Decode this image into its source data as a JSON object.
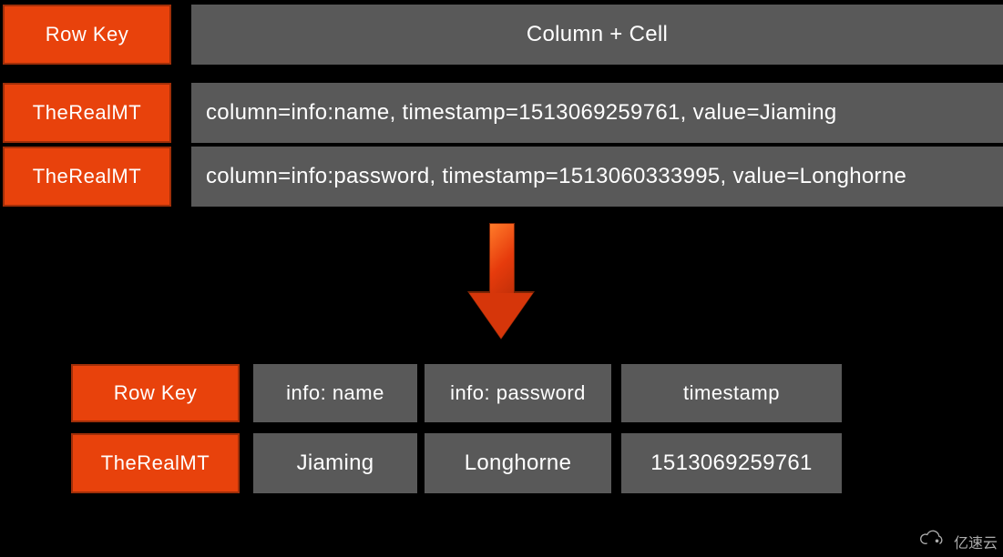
{
  "top": {
    "header": {
      "rowkey": "Row Key",
      "colcell": "Column + Cell"
    },
    "rows": [
      {
        "key": "TheRealMT",
        "cell": "column=info:name, timestamp=1513069259761, value=Jiaming"
      },
      {
        "key": "TheRealMT",
        "cell": "column=info:password, timestamp=1513060333995, value=Longhorne"
      }
    ]
  },
  "bottom": {
    "headers": [
      "Row Key",
      "info: name",
      "info: password",
      "timestamp"
    ],
    "row": [
      "TheRealMT",
      "Jiaming",
      "Longhorne",
      "1513069259761"
    ]
  },
  "arrow": {
    "name": "down-arrow"
  },
  "watermark": {
    "text": "亿速云",
    "icon": "cloud-logo-icon"
  }
}
